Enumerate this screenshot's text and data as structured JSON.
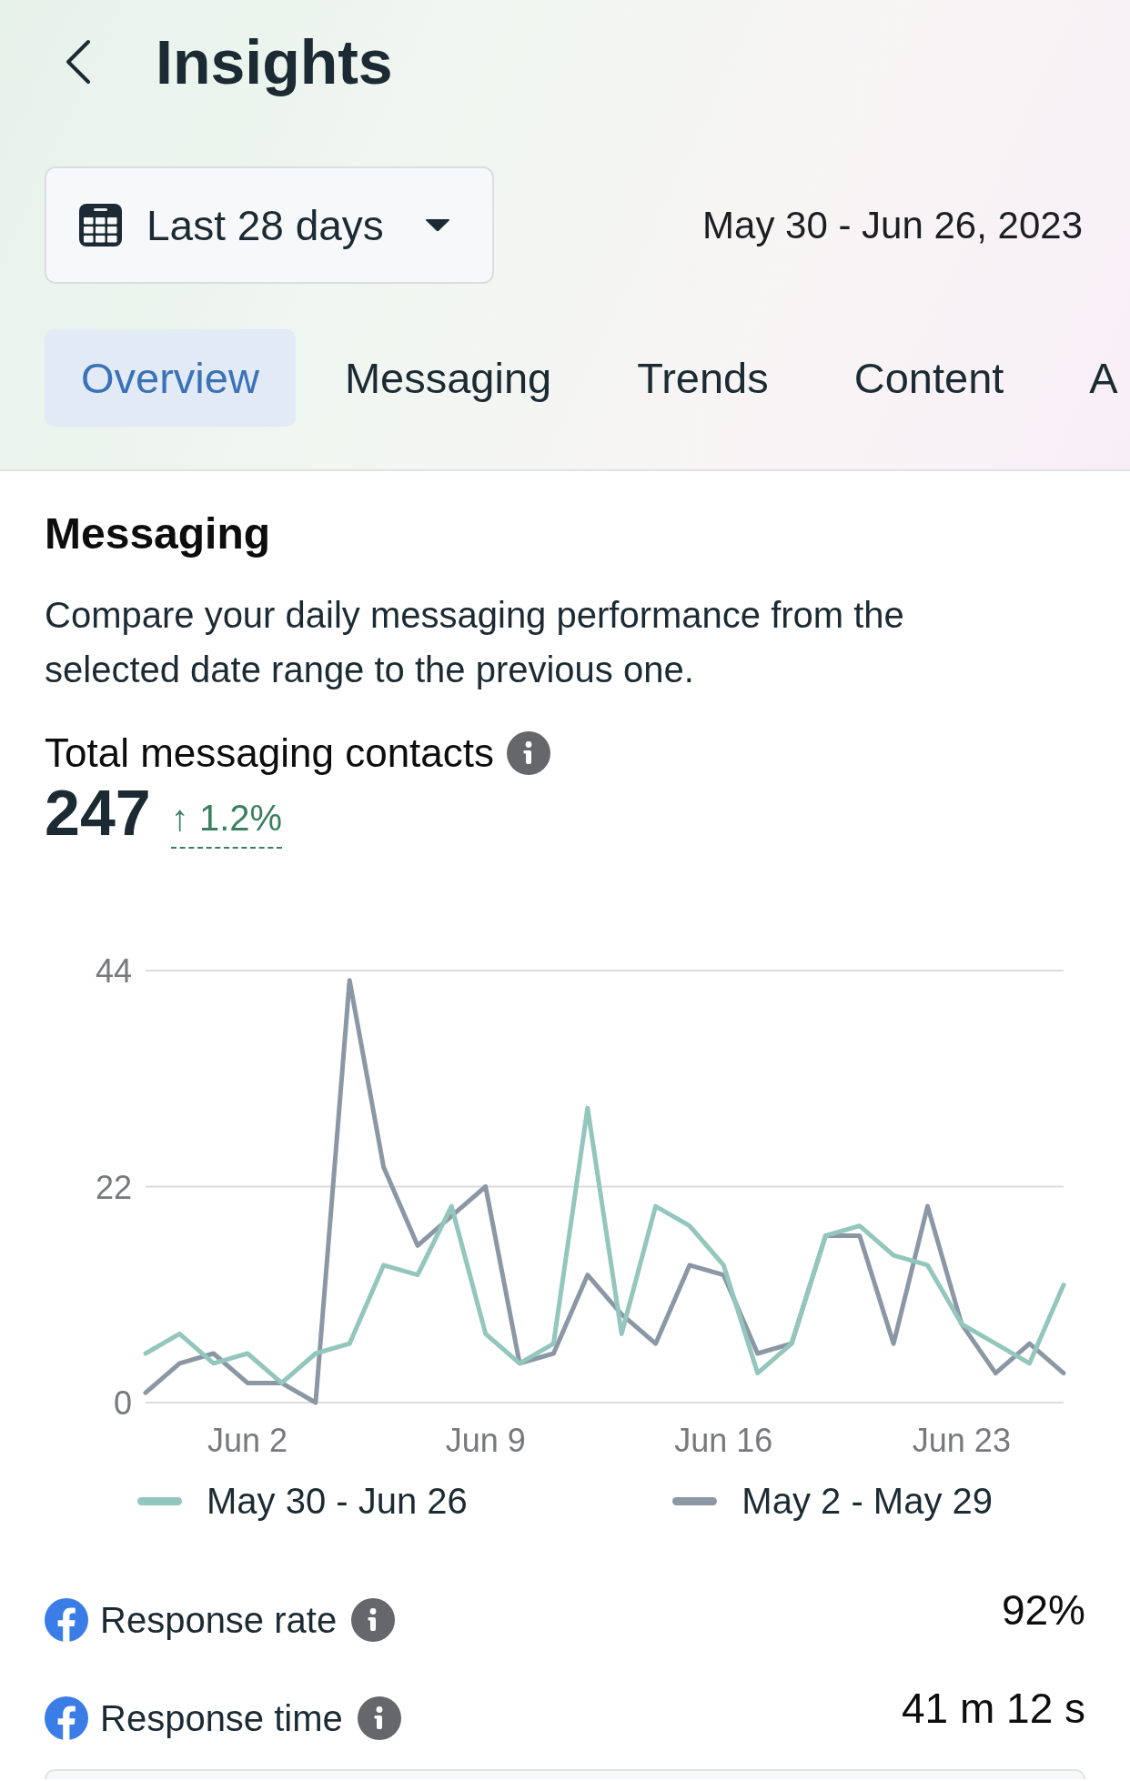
{
  "header": {
    "title": "Insights"
  },
  "date_filter": {
    "label": "Last 28 days",
    "range": "May 30 - Jun 26, 2023"
  },
  "tabs": [
    {
      "label": "Overview",
      "selected": true
    },
    {
      "label": "Messaging",
      "selected": false
    },
    {
      "label": "Trends",
      "selected": false
    },
    {
      "label": "Content",
      "selected": false
    },
    {
      "label": "A",
      "selected": false
    }
  ],
  "messaging": {
    "title": "Messaging",
    "description": "Compare your daily messaging performance from the selected date range to the previous one.",
    "metric": {
      "label": "Total messaging contacts",
      "value": "247",
      "change": "↑ 1.2%"
    },
    "chart": {
      "chart_data": {
        "type": "line",
        "categories": [
          null,
          null,
          null,
          "Jun 2",
          null,
          null,
          null,
          null,
          null,
          null,
          "Jun 9",
          null,
          null,
          null,
          null,
          null,
          null,
          "Jun 16",
          null,
          null,
          null,
          null,
          null,
          null,
          "Jun 23",
          null,
          null,
          null
        ],
        "series": [
          {
            "name": "May 30 - Jun 26",
            "color": "#93c6bc",
            "values": [
              5,
              7,
              4,
              5,
              2,
              5,
              6,
              14,
              13,
              20,
              7,
              4,
              6,
              30,
              7,
              20,
              18,
              14,
              3,
              6,
              17,
              18,
              15,
              14,
              8,
              6,
              4,
              12
            ]
          },
          {
            "name": "May 2 - May 29",
            "color": "#8b97a5",
            "values": [
              1,
              4,
              5,
              2,
              2,
              0,
              43,
              24,
              16,
              19,
              22,
              4,
              5,
              13,
              9,
              6,
              14,
              13,
              5,
              6,
              17,
              17,
              6,
              20,
              8,
              3,
              6,
              3
            ]
          }
        ],
        "ylim": [
          0,
          44
        ],
        "yticks": [
          0,
          22,
          44
        ]
      }
    },
    "stats": [
      {
        "label": "Response rate",
        "value": "92%"
      },
      {
        "label": "Response time",
        "value": "41 m 12 s"
      }
    ]
  }
}
